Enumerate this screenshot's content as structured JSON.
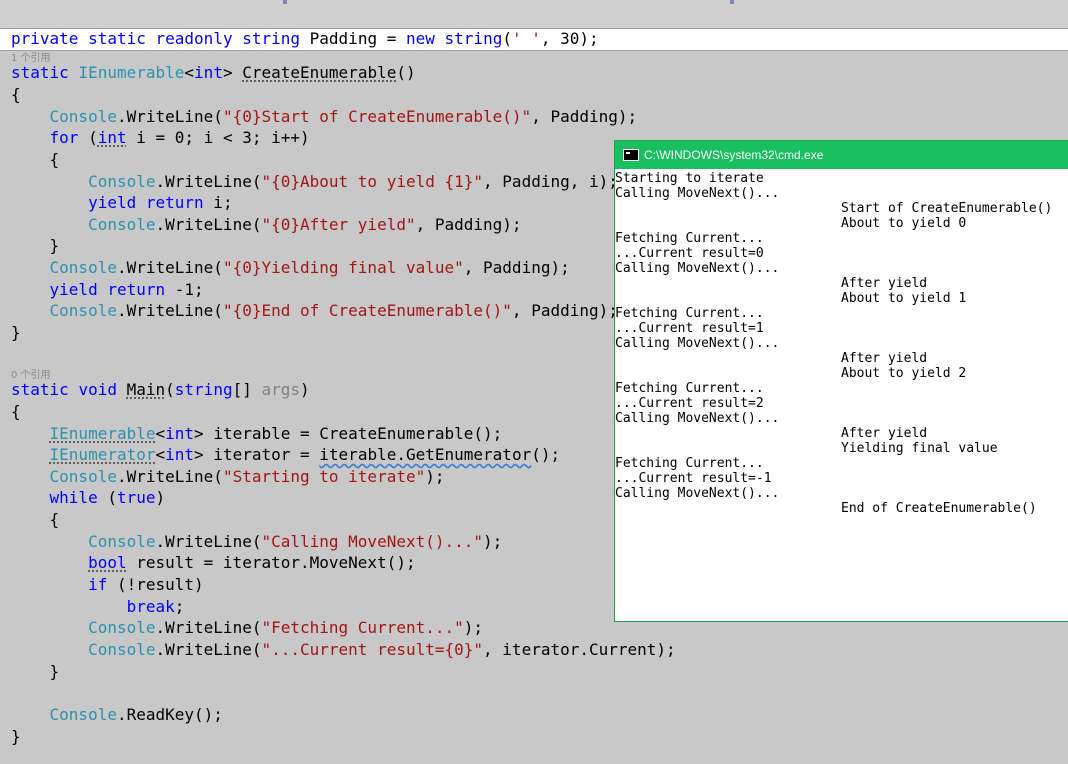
{
  "editor": {
    "ref_1": "1 个引用",
    "ref_0": "0 个引用",
    "lines": {
      "l1": [
        {
          "t": "private",
          "c": "kw"
        },
        {
          "t": " "
        },
        {
          "t": "static",
          "c": "kw"
        },
        {
          "t": " "
        },
        {
          "t": "readonly",
          "c": "kw"
        },
        {
          "t": " "
        },
        {
          "t": "string",
          "c": "kw"
        },
        {
          "t": " Padding = "
        },
        {
          "t": "new",
          "c": "kw"
        },
        {
          "t": " "
        },
        {
          "t": "string",
          "c": "kw"
        },
        {
          "t": "("
        },
        {
          "t": "' '",
          "c": "str"
        },
        {
          "t": ", 30);"
        }
      ],
      "l2": [
        {
          "t": "static",
          "c": "kw"
        },
        {
          "t": " "
        },
        {
          "t": "IEnumerable",
          "c": "ty"
        },
        {
          "t": "<"
        },
        {
          "t": "int",
          "c": "kw"
        },
        {
          "t": "> "
        },
        {
          "t": "CreateEnumerable",
          "c": "dots"
        },
        {
          "t": "()"
        }
      ],
      "l3": [
        {
          "t": "{"
        }
      ],
      "l4": [
        {
          "t": "    "
        },
        {
          "t": "Console",
          "c": "ty"
        },
        {
          "t": ".WriteLine("
        },
        {
          "t": "\"{0}Start of CreateEnumerable()\"",
          "c": "str"
        },
        {
          "t": ", Padding);"
        }
      ],
      "l5": [
        {
          "t": "    "
        },
        {
          "t": "for",
          "c": "kw"
        },
        {
          "t": " ("
        },
        {
          "t": "int",
          "c": "kw dots"
        },
        {
          "t": " i = 0; i < 3; i++)"
        }
      ],
      "l6": [
        {
          "t": "    {"
        }
      ],
      "l7": [
        {
          "t": "        "
        },
        {
          "t": "Console",
          "c": "ty"
        },
        {
          "t": ".WriteLine("
        },
        {
          "t": "\"{0}About to yield {1}\"",
          "c": "str"
        },
        {
          "t": ", Padding, i);"
        }
      ],
      "l8": [
        {
          "t": "        "
        },
        {
          "t": "yield",
          "c": "kw"
        },
        {
          "t": " "
        },
        {
          "t": "return",
          "c": "kw"
        },
        {
          "t": " i;"
        }
      ],
      "l9": [
        {
          "t": "        "
        },
        {
          "t": "Console",
          "c": "ty"
        },
        {
          "t": ".WriteLine("
        },
        {
          "t": "\"{0}After yield\"",
          "c": "str"
        },
        {
          "t": ", Padding);"
        }
      ],
      "l10": [
        {
          "t": "    }"
        }
      ],
      "l11": [
        {
          "t": "    "
        },
        {
          "t": "Console",
          "c": "ty"
        },
        {
          "t": ".WriteLine("
        },
        {
          "t": "\"{0}Yielding final value\"",
          "c": "str"
        },
        {
          "t": ", Padding);"
        }
      ],
      "l12": [
        {
          "t": "    "
        },
        {
          "t": "yield",
          "c": "kw"
        },
        {
          "t": " "
        },
        {
          "t": "return",
          "c": "kw"
        },
        {
          "t": " -1;"
        }
      ],
      "l13": [
        {
          "t": "    "
        },
        {
          "t": "Console",
          "c": "ty"
        },
        {
          "t": ".WriteLine("
        },
        {
          "t": "\"{0}End of CreateEnumerable()\"",
          "c": "str"
        },
        {
          "t": ", Padding);"
        }
      ],
      "l14": [
        {
          "t": "}"
        }
      ],
      "l15": [
        {
          "t": "static",
          "c": "kw"
        },
        {
          "t": " "
        },
        {
          "t": "void",
          "c": "kw"
        },
        {
          "t": " "
        },
        {
          "t": "Main",
          "c": "dots"
        },
        {
          "t": "("
        },
        {
          "t": "string",
          "c": "kw"
        },
        {
          "t": "[] "
        },
        {
          "t": "args",
          "c": "gray"
        },
        {
          "t": ")"
        }
      ],
      "l16": [
        {
          "t": "{"
        }
      ],
      "l17": [
        {
          "t": "    "
        },
        {
          "t": "IEnumerable",
          "c": "ty dots"
        },
        {
          "t": "<"
        },
        {
          "t": "int",
          "c": "kw"
        },
        {
          "t": "> iterable = CreateEnumerable();"
        }
      ],
      "l18": [
        {
          "t": "    "
        },
        {
          "t": "IEnumerator",
          "c": "ty dots"
        },
        {
          "t": "<"
        },
        {
          "t": "int",
          "c": "kw"
        },
        {
          "t": "> iterator = "
        },
        {
          "t": "iterable.GetEnumerator",
          "c": "squig"
        },
        {
          "t": "();"
        }
      ],
      "l19": [
        {
          "t": "    "
        },
        {
          "t": "Console",
          "c": "ty"
        },
        {
          "t": ".WriteLine("
        },
        {
          "t": "\"Starting to iterate\"",
          "c": "str"
        },
        {
          "t": ");"
        }
      ],
      "l20": [
        {
          "t": "    "
        },
        {
          "t": "while",
          "c": "kw"
        },
        {
          "t": " ("
        },
        {
          "t": "true",
          "c": "kw"
        },
        {
          "t": ")"
        }
      ],
      "l21": [
        {
          "t": "    {"
        }
      ],
      "l22": [
        {
          "t": "        "
        },
        {
          "t": "Console",
          "c": "ty"
        },
        {
          "t": ".WriteLine("
        },
        {
          "t": "\"Calling MoveNext()...\"",
          "c": "str"
        },
        {
          "t": ");"
        }
      ],
      "l23": [
        {
          "t": "        "
        },
        {
          "t": "bool",
          "c": "kw dots"
        },
        {
          "t": " result = iterator.MoveNext();"
        }
      ],
      "l24": [
        {
          "t": "        "
        },
        {
          "t": "if",
          "c": "kw"
        },
        {
          "t": " (!result)"
        }
      ],
      "l25": [
        {
          "t": "            "
        },
        {
          "t": "break",
          "c": "kw"
        },
        {
          "t": ";"
        }
      ],
      "l26": [
        {
          "t": "        "
        },
        {
          "t": "Console",
          "c": "ty"
        },
        {
          "t": ".WriteLine("
        },
        {
          "t": "\"Fetching Current...\"",
          "c": "str"
        },
        {
          "t": ");"
        }
      ],
      "l27": [
        {
          "t": "        "
        },
        {
          "t": "Console",
          "c": "ty"
        },
        {
          "t": ".WriteLine("
        },
        {
          "t": "\"...Current result={0}\"",
          "c": "str"
        },
        {
          "t": ", iterator.Current);"
        }
      ],
      "l28": [
        {
          "t": "    }"
        }
      ],
      "l29": [
        {
          "t": "    "
        },
        {
          "t": "Console",
          "c": "ty"
        },
        {
          "t": ".ReadKey();"
        }
      ],
      "l30": [
        {
          "t": "}"
        }
      ]
    }
  },
  "console_window": {
    "title": "C:\\WINDOWS\\system32\\cmd.exe",
    "left_lines": [
      "Starting to iterate",
      "Calling MoveNext()...",
      "",
      "",
      "Fetching Current...",
      "...Current result=0",
      "Calling MoveNext()...",
      "",
      "",
      "Fetching Current...",
      "...Current result=1",
      "Calling MoveNext()...",
      "",
      "",
      "Fetching Current...",
      "...Current result=2",
      "Calling MoveNext()...",
      "",
      "",
      "Fetching Current...",
      "...Current result=-1",
      "Calling MoveNext()...",
      "",
      ""
    ],
    "right_lines": [
      "",
      "",
      "Start of CreateEnumerable()",
      "About to yield 0",
      "",
      "",
      "",
      "After yield",
      "About to yield 1",
      "",
      "",
      "",
      "After yield",
      "About to yield 2",
      "",
      "",
      "",
      "After yield",
      "Yielding final value",
      "",
      "",
      "",
      "End of CreateEnumerable()",
      ""
    ]
  }
}
